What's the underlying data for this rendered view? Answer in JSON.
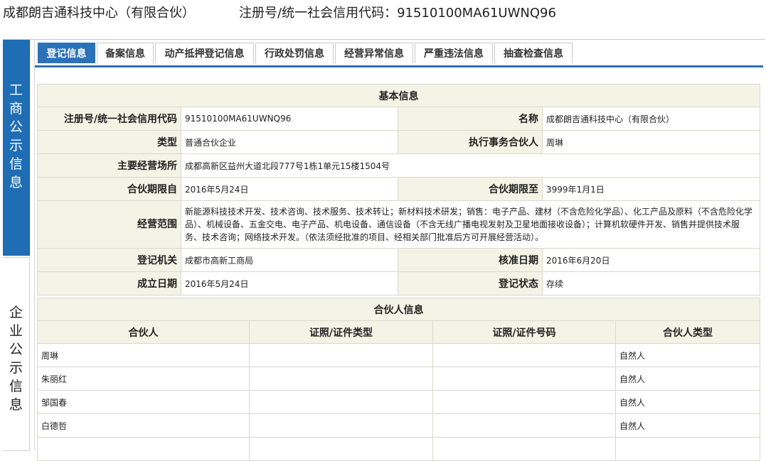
{
  "header": {
    "company": "成都朗吉通科技中心（有限合伙）",
    "reg": "注册号/统一社会信用代码：91510100MA61UWNQ96"
  },
  "sidebar": {
    "active": "工商公示信息",
    "inactive": "企业公示信息"
  },
  "tabs": [
    "登记信息",
    "备案信息",
    "动产抵押登记信息",
    "行政处罚信息",
    "经营异常信息",
    "严重违法信息",
    "抽查检查信息"
  ],
  "basic": {
    "title": "基本信息",
    "reg_label": "注册号/统一社会信用代码",
    "reg_value": "91510100MA61UWNQ96",
    "name_label": "名称",
    "name_value": "成都朗吉通科技中心（有限合伙）",
    "type_label": "类型",
    "type_value": "普通合伙企业",
    "exec_label": "执行事务合伙人",
    "exec_value": "周琳",
    "addr_label": "主要经营场所",
    "addr_value": "成都高新区益州大道北段777号1栋1单元15楼1504号",
    "from_label": "合伙期限自",
    "from_value": "2016年5月24日",
    "to_label": "合伙期限至",
    "to_value": "3999年1月1日",
    "scope_label": "经营范围",
    "scope_value": "新能源科技技术开发、技术咨询、技术服务、技术转让；新材料技术研发；销售：电子产品、建材（不含危险化学品）、化工产品及原料（不含危险化学品）、机械设备、五金交电、电子产品、机电设备、通信设备（不含无线广播电视发射及卫星地面接收设备）；计算机软硬件开发、销售并提供技术服务、技术咨询；网络技术开发。（依法须经批准的项目、经相关部门批准后方可开展经营活动）。",
    "authority_label": "登记机关",
    "authority_value": "成都市高新工商局",
    "approve_label": "核准日期",
    "approve_value": "2016年6月20日",
    "est_label": "成立日期",
    "est_value": "2016年5月24日",
    "status_label": "登记状态",
    "status_value": "存续"
  },
  "partners": {
    "title": "合伙人信息",
    "columns": [
      "合伙人",
      "证照/证件类型",
      "证照/证件号码",
      "合伙人类型"
    ],
    "rows": [
      [
        "周琳",
        "",
        "",
        "自然人"
      ],
      [
        "朱丽红",
        "",
        "",
        "自然人"
      ],
      [
        "邹国春",
        "",
        "",
        "自然人"
      ],
      [
        "白德哲",
        "",
        "",
        "自然人"
      ],
      [
        "",
        "",
        "",
        ""
      ]
    ]
  }
}
